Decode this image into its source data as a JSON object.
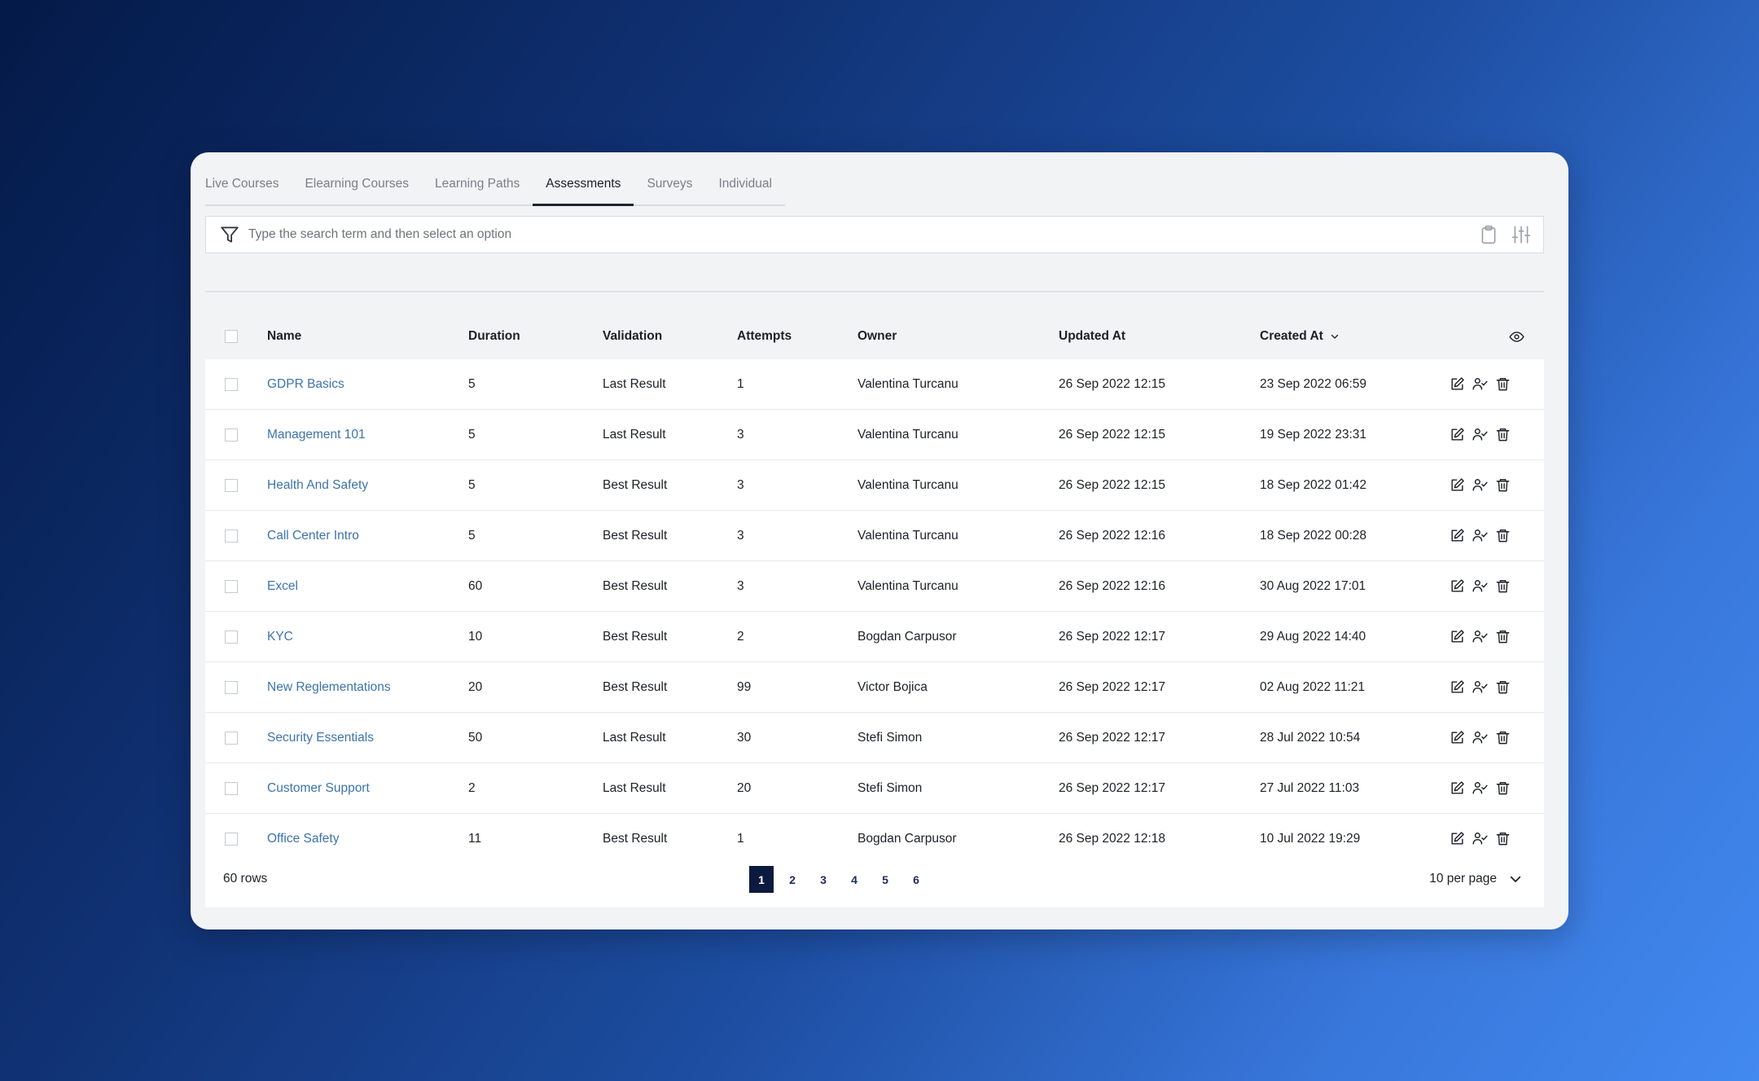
{
  "tabs": [
    {
      "label": "Live Courses"
    },
    {
      "label": "Elearning Courses"
    },
    {
      "label": "Learning Paths"
    },
    {
      "label": "Assessments"
    },
    {
      "label": "Surveys"
    },
    {
      "label": "Individual"
    }
  ],
  "active_tab": "Assessments",
  "search": {
    "placeholder": "Type the search term and then select an option",
    "value": "",
    "icons": [
      "filter-icon",
      "clipboard-icon",
      "sliders-icon"
    ]
  },
  "table": {
    "columns": [
      "Name",
      "Duration",
      "Validation",
      "Attempts",
      "Owner",
      "Updated At",
      "Created At"
    ],
    "sort_column": "Created At",
    "sort_direction": "desc",
    "row_actions": [
      "edit-icon",
      "assign-user-icon",
      "trash-icon"
    ],
    "rows": [
      {
        "name": "GDPR Basics",
        "duration": "5",
        "validation": "Last Result",
        "attempts": "1",
        "owner": "Valentina Turcanu",
        "updated": "26 Sep 2022 12:15",
        "created": "23 Sep 2022 06:59"
      },
      {
        "name": "Management 101",
        "duration": "5",
        "validation": "Last Result",
        "attempts": "3",
        "owner": "Valentina Turcanu",
        "updated": "26 Sep 2022 12:15",
        "created": "19 Sep 2022 23:31"
      },
      {
        "name": "Health And Safety",
        "duration": "5",
        "validation": "Best Result",
        "attempts": "3",
        "owner": "Valentina Turcanu",
        "updated": "26 Sep 2022 12:15",
        "created": "18 Sep 2022 01:42"
      },
      {
        "name": "Call Center Intro",
        "duration": "5",
        "validation": "Best Result",
        "attempts": "3",
        "owner": "Valentina Turcanu",
        "updated": "26 Sep 2022 12:16",
        "created": "18 Sep 2022 00:28"
      },
      {
        "name": "Excel",
        "duration": "60",
        "validation": "Best Result",
        "attempts": "3",
        "owner": "Valentina Turcanu",
        "updated": "26 Sep 2022 12:16",
        "created": "30 Aug 2022 17:01"
      },
      {
        "name": "KYC",
        "duration": "10",
        "validation": "Best Result",
        "attempts": "2",
        "owner": "Bogdan Carpusor",
        "updated": "26 Sep 2022 12:17",
        "created": "29 Aug 2022 14:40"
      },
      {
        "name": "New Reglementations",
        "duration": "20",
        "validation": "Best Result",
        "attempts": "99",
        "owner": "Victor Bojica",
        "updated": "26 Sep 2022 12:17",
        "created": "02 Aug 2022 11:21"
      },
      {
        "name": "Security Essentials",
        "duration": "50",
        "validation": "Last Result",
        "attempts": "30",
        "owner": "Stefi Simon",
        "updated": "26 Sep 2022 12:17",
        "created": "28 Jul 2022 10:54"
      },
      {
        "name": "Customer Support",
        "duration": "2",
        "validation": "Last Result",
        "attempts": "20",
        "owner": "Stefi Simon",
        "updated": "26 Sep 2022 12:17",
        "created": "27 Jul 2022 11:03"
      },
      {
        "name": "Office Safety",
        "duration": "11",
        "validation": "Best Result",
        "attempts": "1",
        "owner": "Bogdan Carpusor",
        "updated": "26 Sep 2022 12:18",
        "created": "10 Jul 2022 19:29"
      }
    ]
  },
  "footer": {
    "rows_count": "60 rows",
    "pages": [
      "1",
      "2",
      "3",
      "4",
      "5",
      "6"
    ],
    "current_page": "1",
    "per_page": "10 per page"
  },
  "colors": {
    "link": "#3d73ac",
    "active_page": "#0c1a3f",
    "card_bg": "#f2f3f5"
  }
}
